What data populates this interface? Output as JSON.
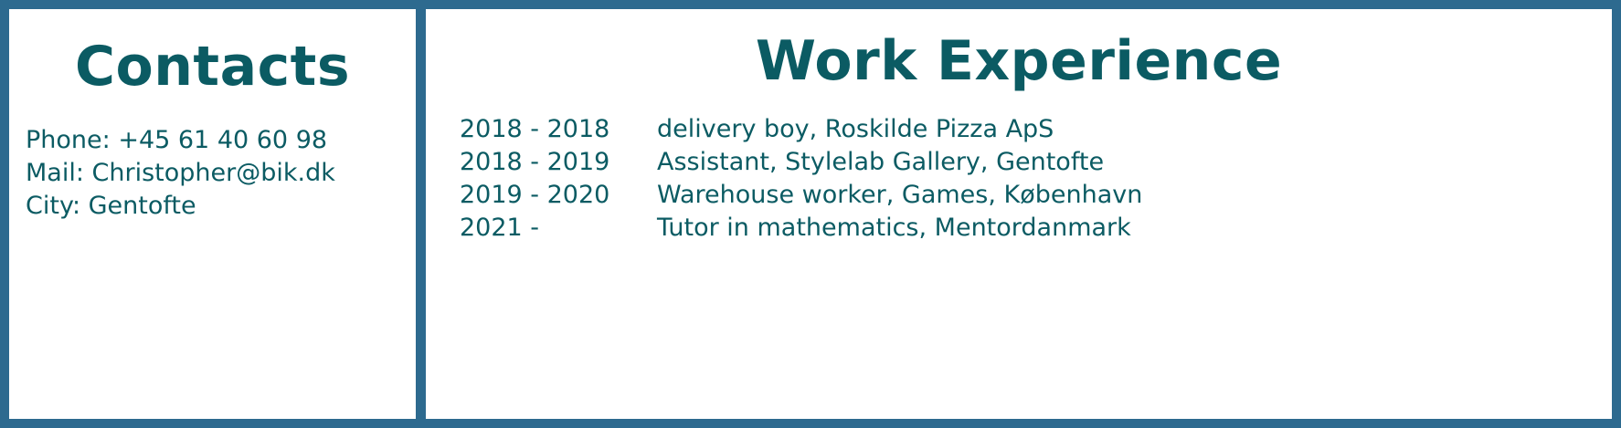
{
  "contacts": {
    "title": "Contacts",
    "lines": [
      "Phone: +45 61 40 60 98",
      "Mail: Christopher@bik.dk",
      "City: Gentofte"
    ]
  },
  "work_experience": {
    "title": "Work Experience",
    "jobs": [
      {
        "years": "2018 - 2018",
        "description": "delivery boy, Roskilde Pizza ApS"
      },
      {
        "years": "2018 - 2019",
        "description": "Assistant, Stylelab Gallery, Gentofte"
      },
      {
        "years": "2019 - 2020",
        "description": "Warehouse worker, Games, København"
      },
      {
        "years": "2021 -",
        "description": "Tutor in mathematics, Mentordanmark"
      }
    ]
  },
  "colors": {
    "frame": "#2d6a8f",
    "text": "#0b5b63",
    "panel": "#ffffff"
  }
}
